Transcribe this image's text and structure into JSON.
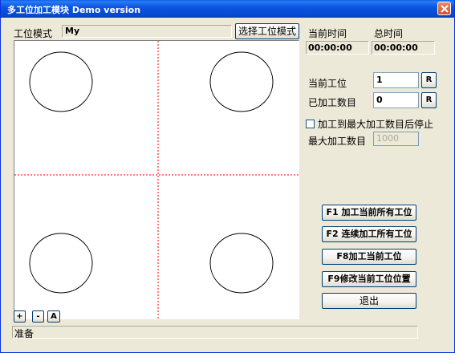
{
  "window": {
    "title": "多工位加工模块 Demo version",
    "close_label": "X"
  },
  "station_mode": {
    "label": "工位模式",
    "value": "My",
    "select_button": "选择工位模式"
  },
  "time": {
    "current_label": "当前时间",
    "current_value": "00:00:00",
    "total_label": "总时间",
    "total_value": "00:00:00"
  },
  "current_station": {
    "label": "当前工位",
    "value": "1",
    "reset_button": "R"
  },
  "processed_count": {
    "label": "已加工数目",
    "value": "0",
    "reset_button": "R"
  },
  "stop_option": {
    "label": "加工到最大加工数目后停止",
    "checked": false
  },
  "max_count": {
    "label": "最大加工数目",
    "value": "1000"
  },
  "actions": {
    "f1": "F1 加工当前所有工位",
    "f2": "F2 连续加工所有工位",
    "f8": "F8加工当前工位",
    "f9": "F9修改当前工位位置",
    "exit": "退出"
  },
  "zoom": {
    "zoom_in": "+",
    "zoom_out": "-",
    "auto": "A"
  },
  "status": {
    "text": "准备"
  },
  "colors": {
    "divider": "#ff0000",
    "circle": "#000000",
    "title_bar": "#0b56e0"
  }
}
